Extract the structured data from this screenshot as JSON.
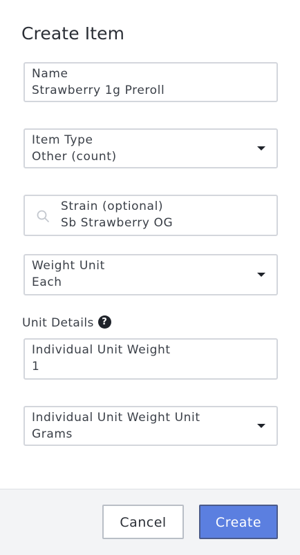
{
  "dialog": {
    "title": "Create Item"
  },
  "fields": {
    "name": {
      "label": "Name",
      "value": "Strawberry 1g Preroll"
    },
    "item_type": {
      "label": "Item Type",
      "value": "Other (count)"
    },
    "strain": {
      "label": "Strain (optional)",
      "value": "Sb Strawberry OG",
      "icon": "search-icon"
    },
    "weight_unit": {
      "label": "Weight Unit",
      "value": "Each"
    },
    "unit_weight": {
      "label": "Individual Unit Weight",
      "value": "1"
    },
    "unit_weight_unit": {
      "label": "Individual Unit Weight Unit",
      "value": "Grams"
    }
  },
  "unit_details": {
    "label": "Unit Details",
    "help_glyph": "?"
  },
  "actions": {
    "cancel_label": "Cancel",
    "create_label": "Create"
  },
  "colors": {
    "primary": "#5b7fe0",
    "border": "#d3d6dc",
    "footer_bg": "#f3f4f6"
  }
}
